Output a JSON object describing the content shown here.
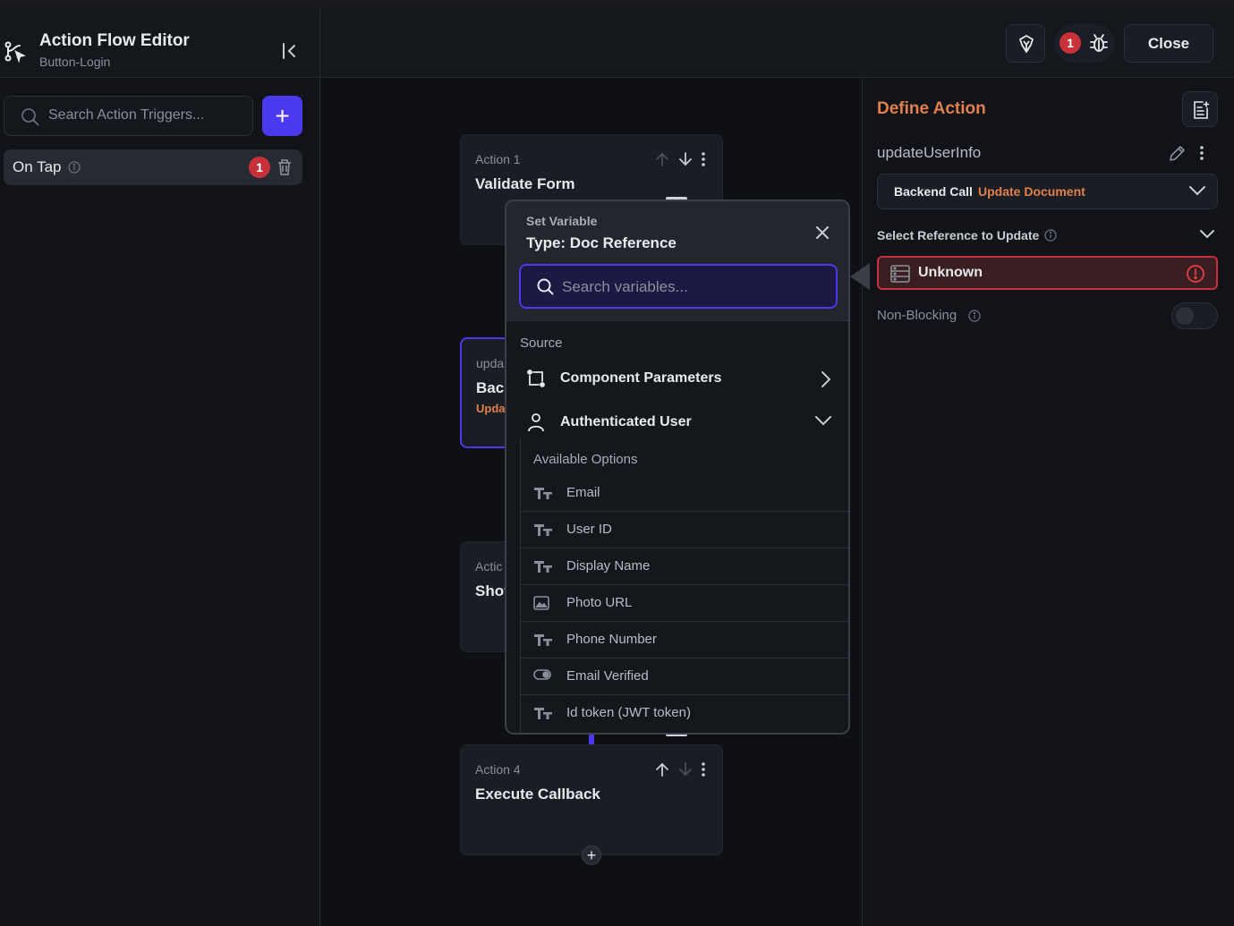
{
  "header": {
    "title": "Action Flow Editor",
    "subtitle": "Button-Login",
    "bug_count": "1",
    "close_label": "Close"
  },
  "triggers": {
    "search_placeholder": "Search Action Triggers...",
    "add_label": "+",
    "items": [
      {
        "label": "On Tap",
        "count": "1"
      }
    ]
  },
  "canvas": {
    "cards": [
      {
        "kind": "Action 1",
        "name": "Validate Form",
        "sub": ""
      },
      {
        "kind": "upda",
        "name": "Bacl",
        "sub": "Upda"
      },
      {
        "kind": "Actic",
        "name": "Shov",
        "sub": ""
      },
      {
        "kind": "Action 4",
        "name": "Execute Callback",
        "sub": ""
      }
    ],
    "add_node_label": "+"
  },
  "popup": {
    "label": "Set Variable",
    "type": "Type: Doc Reference",
    "search_placeholder": "Search variables...",
    "source_label": "Source",
    "sources": [
      {
        "label": "Component Parameters",
        "icon": "component-icon",
        "chevron": "chevron-right"
      },
      {
        "label": "Authenticated User",
        "icon": "user-icon",
        "chevron": "chevron-down"
      }
    ],
    "options_label": "Available Options",
    "options": [
      {
        "label": "Email",
        "icon": "text-type-icon"
      },
      {
        "label": "User ID",
        "icon": "text-type-icon"
      },
      {
        "label": "Display Name",
        "icon": "text-type-icon"
      },
      {
        "label": "Photo URL",
        "icon": "image-icon"
      },
      {
        "label": "Phone Number",
        "icon": "text-type-icon"
      },
      {
        "label": "Email Verified",
        "icon": "toggle-icon"
      },
      {
        "label": "Id token (JWT token)",
        "icon": "text-type-icon"
      }
    ]
  },
  "define": {
    "title": "Define Action",
    "action_name": "updateUserInfo",
    "backend_label": "Backend Call",
    "backend_value": "Update Document",
    "ref_label": "Select Reference to Update",
    "ref_value": "Unknown",
    "nonblocking_label": "Non-Blocking",
    "nonblocking_on": false
  },
  "colors": {
    "accent": "#4b39ef",
    "warning": "#e0804a",
    "error": "#c8303a"
  }
}
